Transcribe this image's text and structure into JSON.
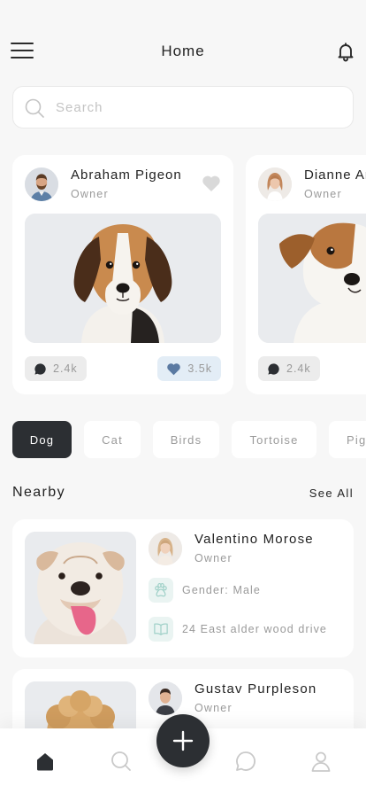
{
  "header": {
    "title": "Home",
    "menu_icon": "hamburger-menu-icon",
    "notification_icon": "bell-icon"
  },
  "search": {
    "placeholder": "Search",
    "value": ""
  },
  "featured_posts": [
    {
      "owner_name": "Abraham Pigeon",
      "owner_role": "Owner",
      "pet": "beagle puppy",
      "comments": "2.4k",
      "likes": "3.5k"
    },
    {
      "owner_name": "Dianne Ar",
      "owner_role": "Owner",
      "pet": "jack russell terrier",
      "comments": "2.4k",
      "likes": ""
    }
  ],
  "categories": [
    {
      "label": "Dog",
      "active": true
    },
    {
      "label": "Cat",
      "active": false
    },
    {
      "label": "Birds",
      "active": false
    },
    {
      "label": "Tortoise",
      "active": false
    },
    {
      "label": "Pig",
      "active": false
    }
  ],
  "nearby": {
    "title": "Nearby",
    "see_all_label": "See All",
    "items": [
      {
        "owner_name": "Valentino Morose",
        "owner_role": "Owner",
        "gender": "Gender: Male",
        "address": "24 East alder wood drive"
      },
      {
        "owner_name": "Gustav Purpleson",
        "owner_role": "Owner",
        "gender": "",
        "address": ""
      }
    ]
  },
  "bottom_nav": {
    "items": [
      "home-icon",
      "search-icon",
      "add-icon",
      "chat-icon",
      "profile-icon"
    ],
    "active": "home-icon"
  },
  "colors": {
    "accent": "#2c2f33",
    "background": "#f7f7f7",
    "muted_text": "#9a9a9a",
    "likes_bg": "#e3edf6",
    "info_bg": "#eaf4f2"
  }
}
